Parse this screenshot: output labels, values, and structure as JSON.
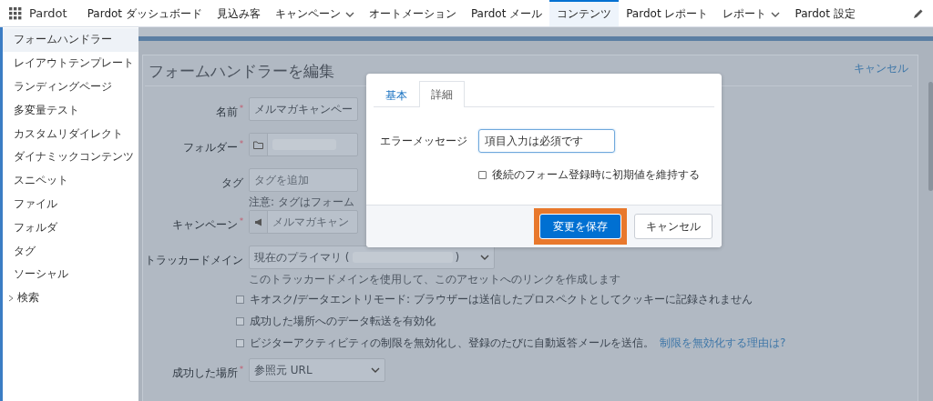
{
  "nav": {
    "brand": "Pardot",
    "tabs": [
      {
        "label": "Pardot ダッシュボード",
        "selected": false,
        "dropdown": false
      },
      {
        "label": "見込み客",
        "selected": false,
        "dropdown": false
      },
      {
        "label": "キャンペーン",
        "selected": false,
        "dropdown": true
      },
      {
        "label": "オートメーション",
        "selected": false,
        "dropdown": false
      },
      {
        "label": "Pardot メール",
        "selected": false,
        "dropdown": false
      },
      {
        "label": "コンテンツ",
        "selected": true,
        "dropdown": false
      },
      {
        "label": "Pardot レポート",
        "selected": false,
        "dropdown": false
      },
      {
        "label": "レポート",
        "selected": false,
        "dropdown": true
      },
      {
        "label": "Pardot 設定",
        "selected": false,
        "dropdown": false
      }
    ]
  },
  "sidebar": {
    "items": [
      {
        "label": "フォームハンドラー",
        "selected": true,
        "expandable": false
      },
      {
        "label": "レイアウトテンプレート",
        "selected": false,
        "expandable": false
      },
      {
        "label": "ランディングページ",
        "selected": false,
        "expandable": false
      },
      {
        "label": "多変量テスト",
        "selected": false,
        "expandable": false
      },
      {
        "label": "カスタムリダイレクト",
        "selected": false,
        "expandable": false
      },
      {
        "label": "ダイナミックコンテンツ",
        "selected": false,
        "expandable": false
      },
      {
        "label": "スニペット",
        "selected": false,
        "expandable": false
      },
      {
        "label": "ファイル",
        "selected": false,
        "expandable": false
      },
      {
        "label": "フォルダ",
        "selected": false,
        "expandable": false
      },
      {
        "label": "タグ",
        "selected": false,
        "expandable": false
      },
      {
        "label": "ソーシャル",
        "selected": false,
        "expandable": false
      },
      {
        "label": "検索",
        "selected": false,
        "expandable": true
      }
    ]
  },
  "form": {
    "title": "フォームハンドラーを編集",
    "cancel": "キャンセル",
    "fields": [
      {
        "kind": "text",
        "label": "名前",
        "required_mark": "*",
        "value": "メルマガキャンペー"
      },
      {
        "kind": "folder",
        "label": "フォルダー",
        "required_mark": "*"
      },
      {
        "kind": "tags",
        "label": "タグ",
        "placeholder": "タグを追加",
        "note": "注意: タグはフォーム"
      },
      {
        "kind": "campaign",
        "label": "キャンペーン",
        "required_mark": "*",
        "placeholder": "メルマガキャン"
      },
      {
        "kind": "domain",
        "label": "トラッカードメイン",
        "value_prefix": "現在のプライマリ (",
        "value_suffix": ")",
        "note": "このトラッカードメインを使用して、このアセットへのリンクを作成します"
      }
    ],
    "options": [
      {
        "label": "キオスク/データエントリモード: ブラウザーは送信したプロスペクトとしてクッキーに記録されません",
        "checked": false
      },
      {
        "label": "成功した場所へのデータ転送を有効化",
        "checked": false
      },
      {
        "label": "ビジターアクティビティの制限を無効化し、登録のたびに自動返答メールを送信。",
        "checked": false,
        "link": "制限を無効化する理由は?"
      }
    ],
    "success": {
      "label": "成功した場所",
      "required_mark": "*",
      "value": "参照元 URL"
    }
  },
  "dialog": {
    "tabs": [
      {
        "label": "基本",
        "selected": false
      },
      {
        "label": "詳細",
        "selected": true
      }
    ],
    "error_label": "エラーメッセージ",
    "error_value": "項目入力は必須です",
    "keep_default": {
      "label": "後続のフォーム登録時に初期値を維持する",
      "checked": false
    },
    "save": "変更を保存",
    "cancel": "キャンセル",
    "save_highlighted": true
  }
}
